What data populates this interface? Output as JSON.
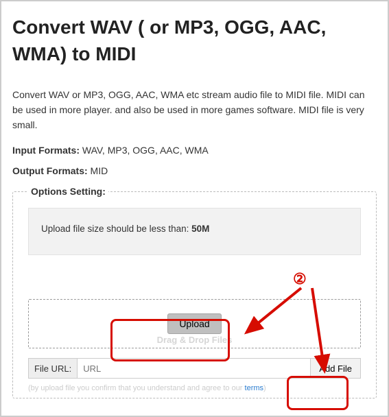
{
  "title": "Convert WAV ( or MP3, OGG, AAC, WMA) to MIDI",
  "description": "Convert WAV or MP3, OGG, AAC, WMA etc stream audio file to MIDI file. MIDI can be used in more player. and also be used in more games software. MIDI file is very small.",
  "input_formats_label": "Input Formats:",
  "input_formats_value": " WAV, MP3, OGG, AAC, WMA",
  "output_formats_label": "Output Formats:",
  "output_formats_value": " MID",
  "options": {
    "legend": "Options Setting:",
    "notice_prefix": "Upload file size should be less than: ",
    "notice_limit": "50M",
    "upload_button": "Upload",
    "drag_drop_hint": "Drag & Drop Files",
    "file_url_label": "File URL:",
    "url_placeholder": "URL",
    "add_file_button": "Add File",
    "confirm_text": "(by upload file you confirm that you understand and agree to our ",
    "terms_link": "terms",
    "confirm_suffix": ")"
  },
  "annotation": {
    "badge": "②",
    "color": "#d60c00"
  }
}
